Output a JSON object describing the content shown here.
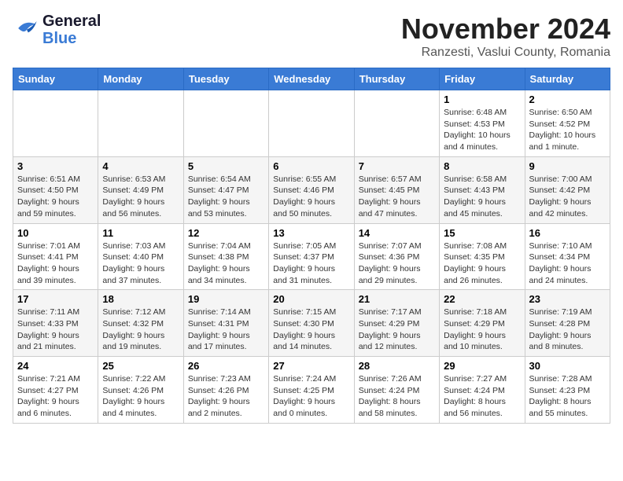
{
  "header": {
    "logo_general": "General",
    "logo_blue": "Blue",
    "month_title": "November 2024",
    "subtitle": "Ranzesti, Vaslui County, Romania"
  },
  "days_of_week": [
    "Sunday",
    "Monday",
    "Tuesday",
    "Wednesday",
    "Thursday",
    "Friday",
    "Saturday"
  ],
  "weeks": [
    [
      {
        "day": "",
        "sunrise": "",
        "sunset": "",
        "daylight": ""
      },
      {
        "day": "",
        "sunrise": "",
        "sunset": "",
        "daylight": ""
      },
      {
        "day": "",
        "sunrise": "",
        "sunset": "",
        "daylight": ""
      },
      {
        "day": "",
        "sunrise": "",
        "sunset": "",
        "daylight": ""
      },
      {
        "day": "",
        "sunrise": "",
        "sunset": "",
        "daylight": ""
      },
      {
        "day": "1",
        "sunrise": "Sunrise: 6:48 AM",
        "sunset": "Sunset: 4:53 PM",
        "daylight": "Daylight: 10 hours and 4 minutes."
      },
      {
        "day": "2",
        "sunrise": "Sunrise: 6:50 AM",
        "sunset": "Sunset: 4:52 PM",
        "daylight": "Daylight: 10 hours and 1 minute."
      }
    ],
    [
      {
        "day": "3",
        "sunrise": "Sunrise: 6:51 AM",
        "sunset": "Sunset: 4:50 PM",
        "daylight": "Daylight: 9 hours and 59 minutes."
      },
      {
        "day": "4",
        "sunrise": "Sunrise: 6:53 AM",
        "sunset": "Sunset: 4:49 PM",
        "daylight": "Daylight: 9 hours and 56 minutes."
      },
      {
        "day": "5",
        "sunrise": "Sunrise: 6:54 AM",
        "sunset": "Sunset: 4:47 PM",
        "daylight": "Daylight: 9 hours and 53 minutes."
      },
      {
        "day": "6",
        "sunrise": "Sunrise: 6:55 AM",
        "sunset": "Sunset: 4:46 PM",
        "daylight": "Daylight: 9 hours and 50 minutes."
      },
      {
        "day": "7",
        "sunrise": "Sunrise: 6:57 AM",
        "sunset": "Sunset: 4:45 PM",
        "daylight": "Daylight: 9 hours and 47 minutes."
      },
      {
        "day": "8",
        "sunrise": "Sunrise: 6:58 AM",
        "sunset": "Sunset: 4:43 PM",
        "daylight": "Daylight: 9 hours and 45 minutes."
      },
      {
        "day": "9",
        "sunrise": "Sunrise: 7:00 AM",
        "sunset": "Sunset: 4:42 PM",
        "daylight": "Daylight: 9 hours and 42 minutes."
      }
    ],
    [
      {
        "day": "10",
        "sunrise": "Sunrise: 7:01 AM",
        "sunset": "Sunset: 4:41 PM",
        "daylight": "Daylight: 9 hours and 39 minutes."
      },
      {
        "day": "11",
        "sunrise": "Sunrise: 7:03 AM",
        "sunset": "Sunset: 4:40 PM",
        "daylight": "Daylight: 9 hours and 37 minutes."
      },
      {
        "day": "12",
        "sunrise": "Sunrise: 7:04 AM",
        "sunset": "Sunset: 4:38 PM",
        "daylight": "Daylight: 9 hours and 34 minutes."
      },
      {
        "day": "13",
        "sunrise": "Sunrise: 7:05 AM",
        "sunset": "Sunset: 4:37 PM",
        "daylight": "Daylight: 9 hours and 31 minutes."
      },
      {
        "day": "14",
        "sunrise": "Sunrise: 7:07 AM",
        "sunset": "Sunset: 4:36 PM",
        "daylight": "Daylight: 9 hours and 29 minutes."
      },
      {
        "day": "15",
        "sunrise": "Sunrise: 7:08 AM",
        "sunset": "Sunset: 4:35 PM",
        "daylight": "Daylight: 9 hours and 26 minutes."
      },
      {
        "day": "16",
        "sunrise": "Sunrise: 7:10 AM",
        "sunset": "Sunset: 4:34 PM",
        "daylight": "Daylight: 9 hours and 24 minutes."
      }
    ],
    [
      {
        "day": "17",
        "sunrise": "Sunrise: 7:11 AM",
        "sunset": "Sunset: 4:33 PM",
        "daylight": "Daylight: 9 hours and 21 minutes."
      },
      {
        "day": "18",
        "sunrise": "Sunrise: 7:12 AM",
        "sunset": "Sunset: 4:32 PM",
        "daylight": "Daylight: 9 hours and 19 minutes."
      },
      {
        "day": "19",
        "sunrise": "Sunrise: 7:14 AM",
        "sunset": "Sunset: 4:31 PM",
        "daylight": "Daylight: 9 hours and 17 minutes."
      },
      {
        "day": "20",
        "sunrise": "Sunrise: 7:15 AM",
        "sunset": "Sunset: 4:30 PM",
        "daylight": "Daylight: 9 hours and 14 minutes."
      },
      {
        "day": "21",
        "sunrise": "Sunrise: 7:17 AM",
        "sunset": "Sunset: 4:29 PM",
        "daylight": "Daylight: 9 hours and 12 minutes."
      },
      {
        "day": "22",
        "sunrise": "Sunrise: 7:18 AM",
        "sunset": "Sunset: 4:29 PM",
        "daylight": "Daylight: 9 hours and 10 minutes."
      },
      {
        "day": "23",
        "sunrise": "Sunrise: 7:19 AM",
        "sunset": "Sunset: 4:28 PM",
        "daylight": "Daylight: 9 hours and 8 minutes."
      }
    ],
    [
      {
        "day": "24",
        "sunrise": "Sunrise: 7:21 AM",
        "sunset": "Sunset: 4:27 PM",
        "daylight": "Daylight: 9 hours and 6 minutes."
      },
      {
        "day": "25",
        "sunrise": "Sunrise: 7:22 AM",
        "sunset": "Sunset: 4:26 PM",
        "daylight": "Daylight: 9 hours and 4 minutes."
      },
      {
        "day": "26",
        "sunrise": "Sunrise: 7:23 AM",
        "sunset": "Sunset: 4:26 PM",
        "daylight": "Daylight: 9 hours and 2 minutes."
      },
      {
        "day": "27",
        "sunrise": "Sunrise: 7:24 AM",
        "sunset": "Sunset: 4:25 PM",
        "daylight": "Daylight: 9 hours and 0 minutes."
      },
      {
        "day": "28",
        "sunrise": "Sunrise: 7:26 AM",
        "sunset": "Sunset: 4:24 PM",
        "daylight": "Daylight: 8 hours and 58 minutes."
      },
      {
        "day": "29",
        "sunrise": "Sunrise: 7:27 AM",
        "sunset": "Sunset: 4:24 PM",
        "daylight": "Daylight: 8 hours and 56 minutes."
      },
      {
        "day": "30",
        "sunrise": "Sunrise: 7:28 AM",
        "sunset": "Sunset: 4:23 PM",
        "daylight": "Daylight: 8 hours and 55 minutes."
      }
    ]
  ]
}
